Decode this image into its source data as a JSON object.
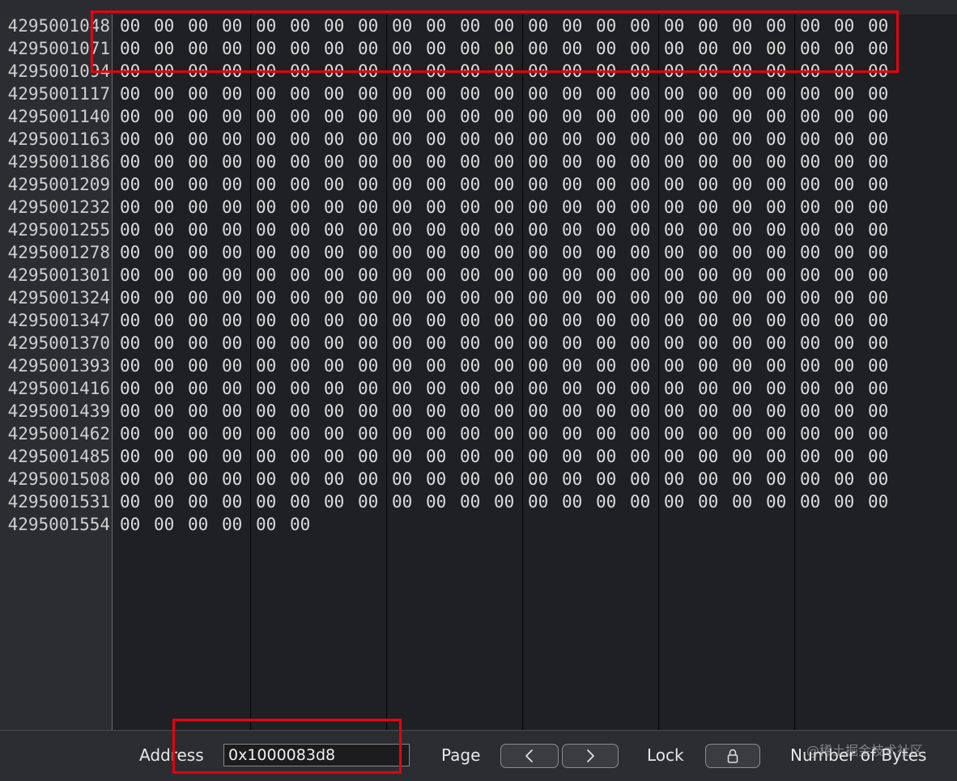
{
  "memory": {
    "addresses": [
      "4295001048",
      "4295001071",
      "4295001094",
      "4295001117",
      "4295001140",
      "4295001163",
      "4295001186",
      "4295001209",
      "4295001232",
      "4295001255",
      "4295001278",
      "4295001301",
      "4295001324",
      "4295001347",
      "4295001370",
      "4295001393",
      "4295001416",
      "4295001439",
      "4295001462",
      "4295001485",
      "4295001508",
      "4295001531",
      "4295001554"
    ],
    "byte_value": "00",
    "bytes_per_row": 23,
    "last_row_bytes": 6,
    "ascii_text": "....",
    "group_size": 4
  },
  "toolbar": {
    "address_label": "Address",
    "address_value": "0x1000083d8",
    "page_label": "Page",
    "lock_label": "Lock",
    "number_of_bytes_label": "Number of Bytes"
  },
  "watermark": {
    "text": "@稀土掘金技术社区"
  },
  "icons": {
    "prev": "chevron-left-icon",
    "next": "chevron-right-icon",
    "lock": "lock-icon"
  },
  "colors": {
    "highlight": "#e60012",
    "background": "#1f2023",
    "text": "#dcdcdc"
  }
}
